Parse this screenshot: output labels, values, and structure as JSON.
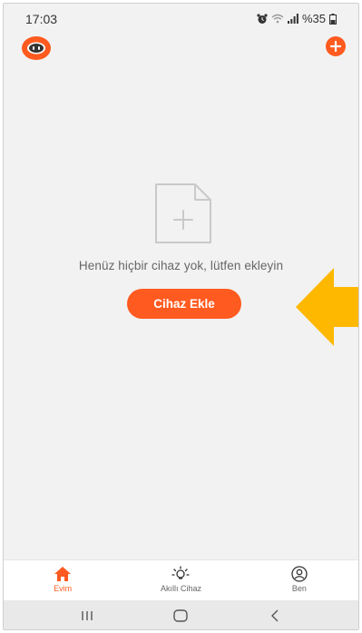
{
  "status_bar": {
    "time": "17:03",
    "battery": "%35",
    "icons": [
      "alarm-icon",
      "wifi-icon",
      "signal-icon",
      "battery-icon"
    ]
  },
  "header": {
    "avatar_icon": "robot-avatar-icon",
    "add_icon": "plus-circle-icon"
  },
  "empty_state": {
    "icon": "add-file-icon",
    "message": "Henüz hiçbir cihaz yok, lütfen ekleyin",
    "button_label": "Cihaz Ekle"
  },
  "annotation": {
    "arrow_icon": "yellow-arrow-left-icon",
    "arrow_color": "#ffb800"
  },
  "tabs": [
    {
      "label": "Evim",
      "icon": "home-icon",
      "active": true
    },
    {
      "label": "Akıllı Cihaz",
      "icon": "sun-bulb-icon",
      "active": false
    },
    {
      "label": "Ben",
      "icon": "user-icon",
      "active": false
    }
  ],
  "nav_bar": {
    "recents": "|||",
    "home": "home-nav-icon",
    "back": "<"
  },
  "colors": {
    "accent": "#ff5a1f",
    "background": "#f2f2f2"
  }
}
